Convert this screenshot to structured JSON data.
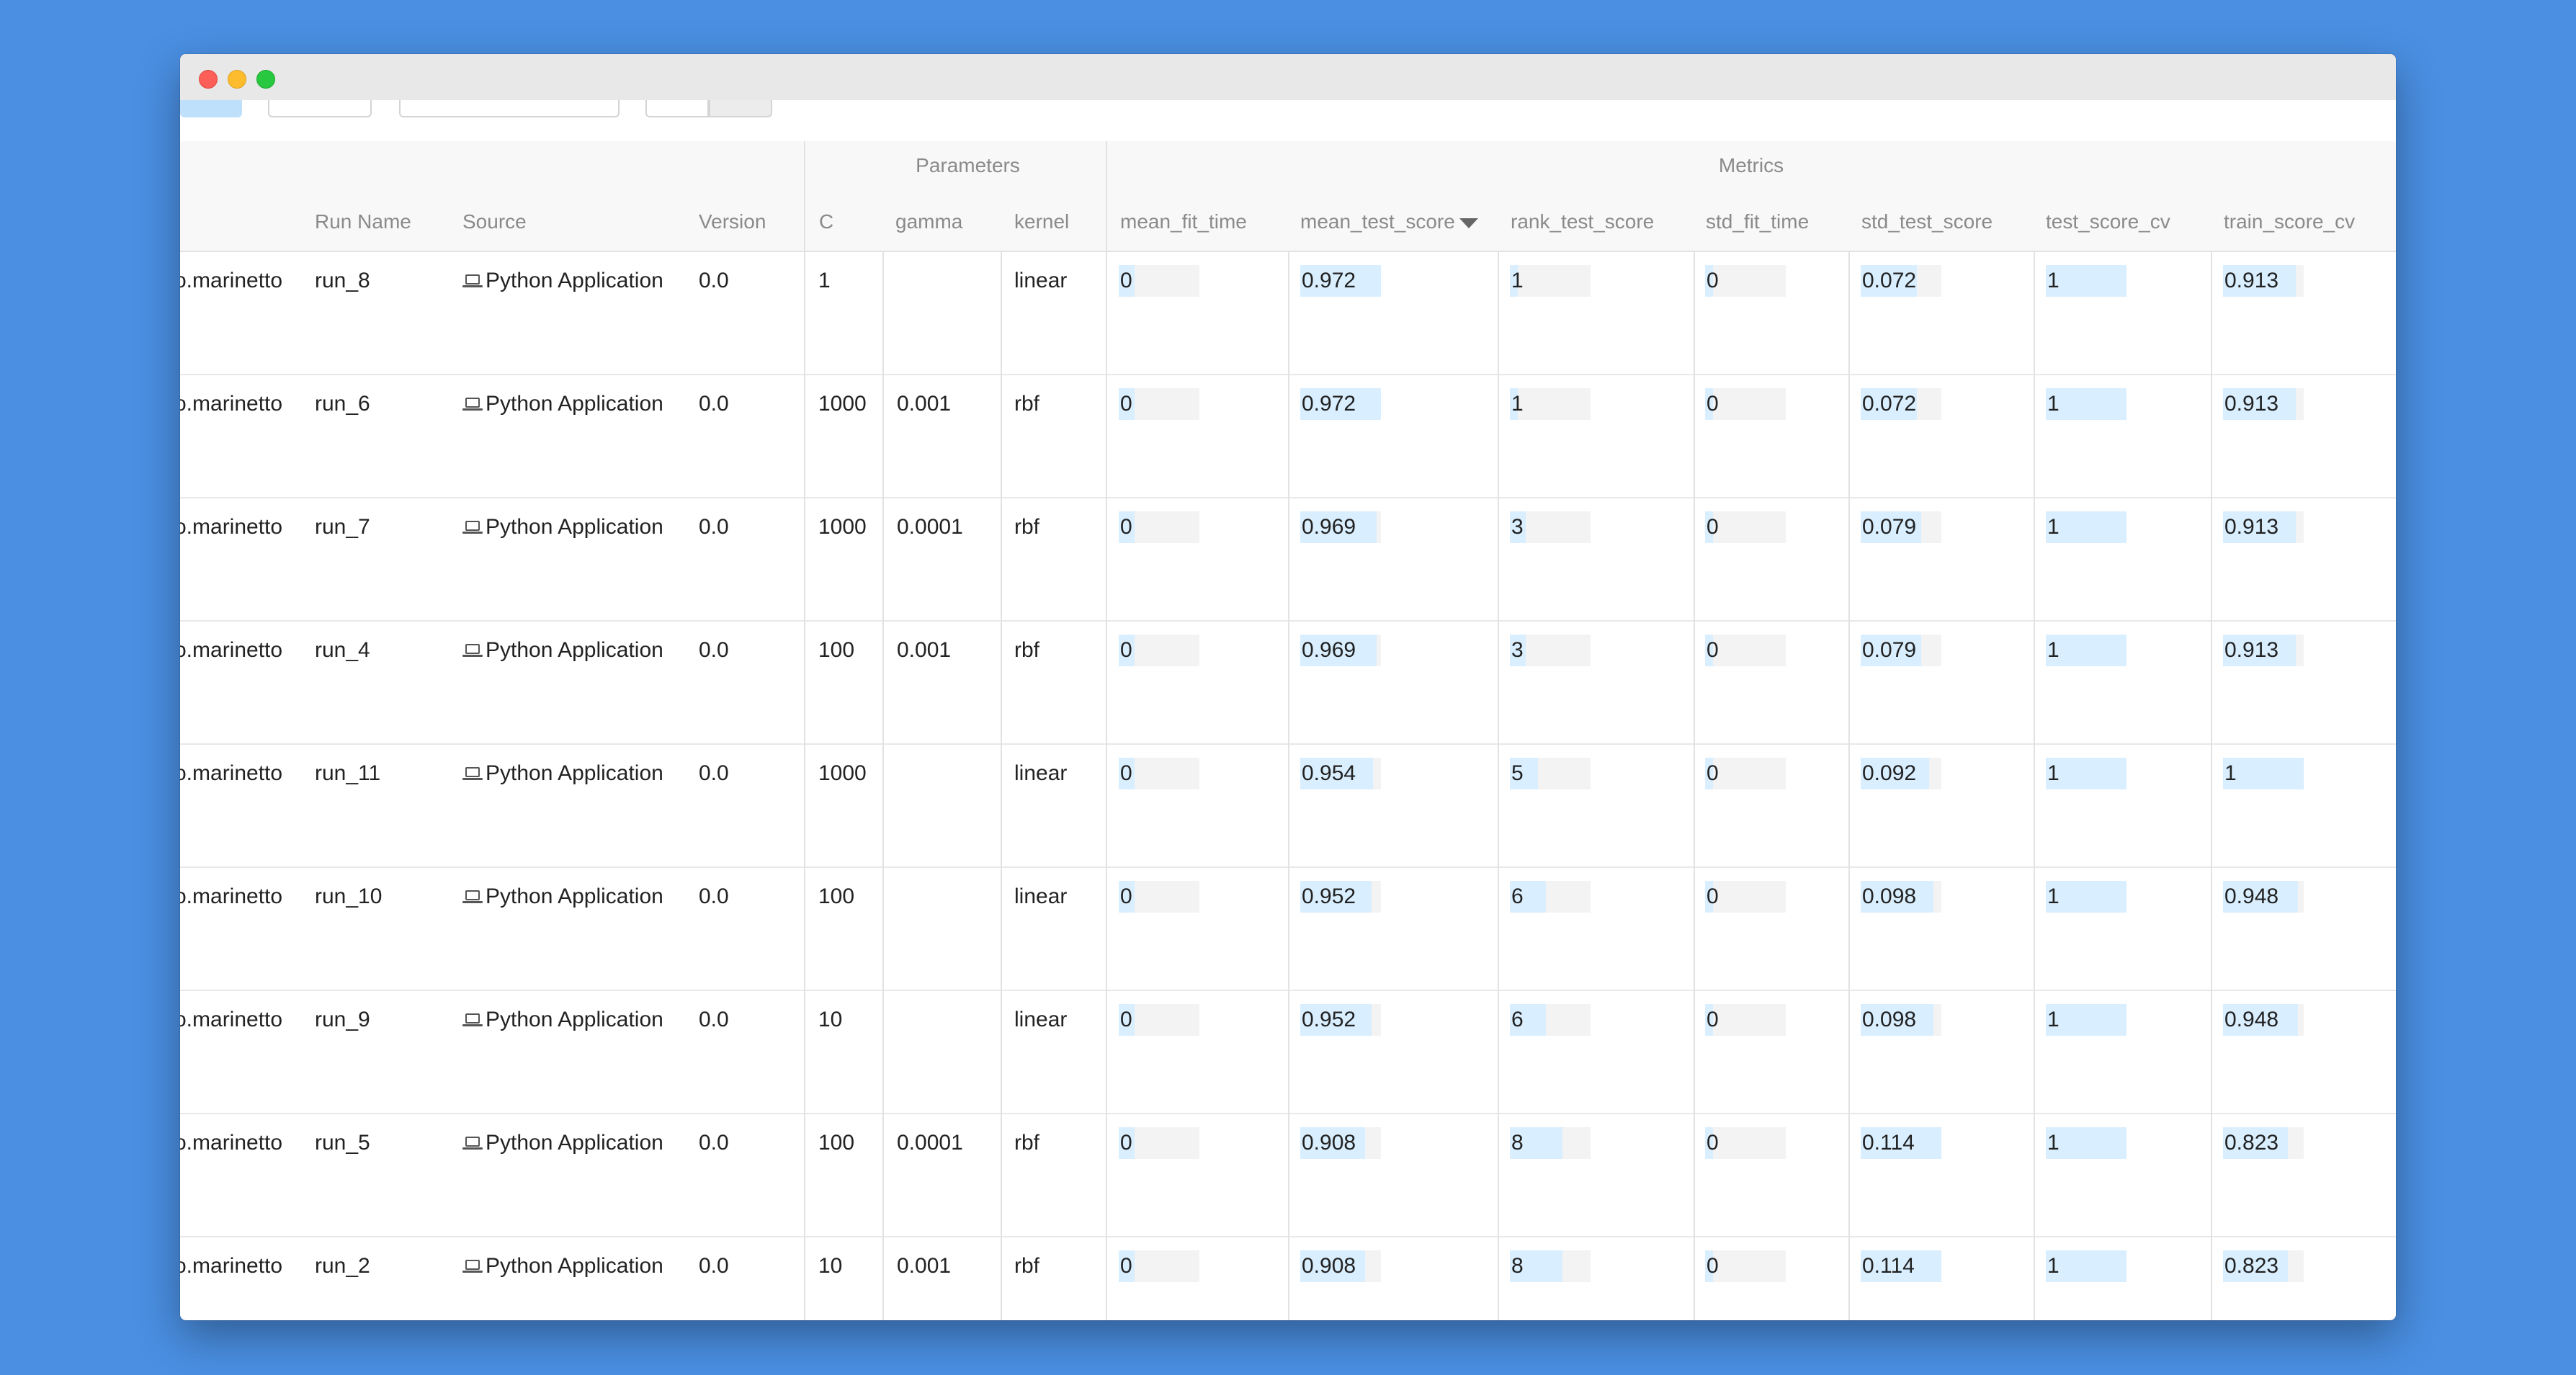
{
  "groups": {
    "parameters": "Parameters",
    "metrics": "Metrics"
  },
  "columns": {
    "run_name": "Run Name",
    "source": "Source",
    "version": "Version",
    "C": "C",
    "gamma": "gamma",
    "kernel": "kernel",
    "mean_fit_time": "mean_fit_time",
    "mean_test_score": "mean_test_score",
    "rank_test_score": "rank_test_score",
    "std_fit_time": "std_fit_time",
    "std_test_score": "std_test_score",
    "test_score_cv": "test_score_cv",
    "train_score_cv": "train_score_cv"
  },
  "sort": {
    "column": "mean_test_score",
    "direction": "descending",
    "icon": "caret-down-icon"
  },
  "source_icon": "laptop-icon",
  "rows": [
    {
      "user": "o.marinetto",
      "run": "run_8",
      "source": "Python Application",
      "version": "0.0",
      "C": "1",
      "gamma": "",
      "kernel": "linear",
      "mean_fit_time": "0",
      "mean_test_score": "0.972",
      "rank_test_score": "1",
      "std_fit_time": "0",
      "std_test_score": "0.072",
      "test_score_cv": "1",
      "train_score_cv": "0.913"
    },
    {
      "user": "o.marinetto",
      "run": "run_6",
      "source": "Python Application",
      "version": "0.0",
      "C": "1000",
      "gamma": "0.001",
      "kernel": "rbf",
      "mean_fit_time": "0",
      "mean_test_score": "0.972",
      "rank_test_score": "1",
      "std_fit_time": "0",
      "std_test_score": "0.072",
      "test_score_cv": "1",
      "train_score_cv": "0.913"
    },
    {
      "user": "o.marinetto",
      "run": "run_7",
      "source": "Python Application",
      "version": "0.0",
      "C": "1000",
      "gamma": "0.0001",
      "kernel": "rbf",
      "mean_fit_time": "0",
      "mean_test_score": "0.969",
      "rank_test_score": "3",
      "std_fit_time": "0",
      "std_test_score": "0.079",
      "test_score_cv": "1",
      "train_score_cv": "0.913"
    },
    {
      "user": "o.marinetto",
      "run": "run_4",
      "source": "Python Application",
      "version": "0.0",
      "C": "100",
      "gamma": "0.001",
      "kernel": "rbf",
      "mean_fit_time": "0",
      "mean_test_score": "0.969",
      "rank_test_score": "3",
      "std_fit_time": "0",
      "std_test_score": "0.079",
      "test_score_cv": "1",
      "train_score_cv": "0.913"
    },
    {
      "user": "o.marinetto",
      "run": "run_11",
      "source": "Python Application",
      "version": "0.0",
      "C": "1000",
      "gamma": "",
      "kernel": "linear",
      "mean_fit_time": "0",
      "mean_test_score": "0.954",
      "rank_test_score": "5",
      "std_fit_time": "0",
      "std_test_score": "0.092",
      "test_score_cv": "1",
      "train_score_cv": "1"
    },
    {
      "user": "o.marinetto",
      "run": "run_10",
      "source": "Python Application",
      "version": "0.0",
      "C": "100",
      "gamma": "",
      "kernel": "linear",
      "mean_fit_time": "0",
      "mean_test_score": "0.952",
      "rank_test_score": "6",
      "std_fit_time": "0",
      "std_test_score": "0.098",
      "test_score_cv": "1",
      "train_score_cv": "0.948"
    },
    {
      "user": "o.marinetto",
      "run": "run_9",
      "source": "Python Application",
      "version": "0.0",
      "C": "10",
      "gamma": "",
      "kernel": "linear",
      "mean_fit_time": "0",
      "mean_test_score": "0.952",
      "rank_test_score": "6",
      "std_fit_time": "0",
      "std_test_score": "0.098",
      "test_score_cv": "1",
      "train_score_cv": "0.948"
    },
    {
      "user": "o.marinetto",
      "run": "run_5",
      "source": "Python Application",
      "version": "0.0",
      "C": "100",
      "gamma": "0.0001",
      "kernel": "rbf",
      "mean_fit_time": "0",
      "mean_test_score": "0.908",
      "rank_test_score": "8",
      "std_fit_time": "0",
      "std_test_score": "0.114",
      "test_score_cv": "1",
      "train_score_cv": "0.823"
    },
    {
      "user": "o.marinetto",
      "run": "run_2",
      "source": "Python Application",
      "version": "0.0",
      "C": "10",
      "gamma": "0.001",
      "kernel": "rbf",
      "mean_fit_time": "0",
      "mean_test_score": "0.908",
      "rank_test_score": "8",
      "std_fit_time": "0",
      "std_test_score": "0.114",
      "test_score_cv": "1",
      "train_score_cv": "0.823"
    }
  ],
  "bar_fill": {
    "mean_fit_time": [
      0.2,
      0.2,
      0.2,
      0.2,
      0.2,
      0.2,
      0.2,
      0.2,
      0.2
    ],
    "mean_test_score": [
      1.0,
      1.0,
      0.95,
      0.95,
      0.9,
      0.88,
      0.88,
      0.8,
      0.8
    ],
    "rank_test_score": [
      0.1,
      0.1,
      0.2,
      0.2,
      0.35,
      0.45,
      0.45,
      0.65,
      0.65
    ],
    "std_fit_time": [
      0.1,
      0.1,
      0.1,
      0.1,
      0.1,
      0.1,
      0.1,
      0.1,
      0.1
    ],
    "std_test_score": [
      0.7,
      0.7,
      0.75,
      0.75,
      0.85,
      0.9,
      0.9,
      1.0,
      1.0
    ],
    "test_score_cv": [
      1.0,
      1.0,
      1.0,
      1.0,
      1.0,
      1.0,
      1.0,
      1.0,
      1.0
    ],
    "train_score_cv": [
      0.9,
      0.9,
      0.9,
      0.9,
      1.0,
      0.93,
      0.93,
      0.8,
      0.8
    ]
  }
}
